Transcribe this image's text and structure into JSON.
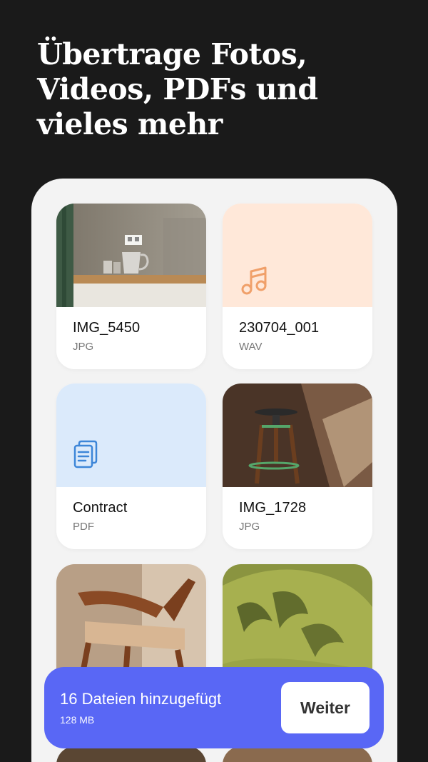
{
  "headline": {
    "line1": "Übertrage Fotos,",
    "line2": "Videos, PDFs und",
    "line3": "vieles mehr"
  },
  "files": [
    {
      "name": "IMG_5450",
      "type": "JPG",
      "thumb": "photo-kitchen"
    },
    {
      "name": "230704_001",
      "type": "WAV",
      "thumb": "music-note-icon",
      "bg": "#ffe8d9",
      "icon_color": "#f0a06a"
    },
    {
      "name": "Contract",
      "type": "PDF",
      "thumb": "document-icon",
      "bg": "#dbeafb",
      "icon_color": "#3d86d8"
    },
    {
      "name": "IMG_1728",
      "type": "JPG",
      "thumb": "photo-stool"
    },
    {
      "name": "",
      "type": "",
      "thumb": "photo-chair"
    },
    {
      "name": "",
      "type": "",
      "thumb": "photo-plant-shadow"
    }
  ],
  "transfer_bar": {
    "count_label": "16 Dateien hinzugefügt",
    "size_label": "128 MB",
    "next_label": "Weiter",
    "color": "#5967f5"
  }
}
